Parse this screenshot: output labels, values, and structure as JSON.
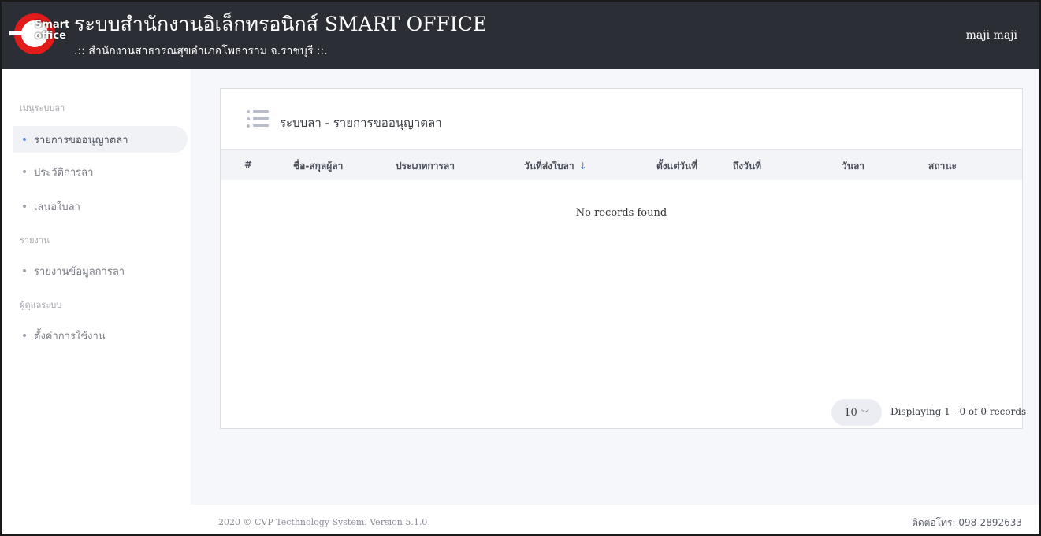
{
  "header": {
    "logo_top": "Smart",
    "logo_bottom": "office",
    "title": "ระบบสำนักงานอิเล็กทรอนิกส์ SMART OFFICE",
    "subtitle": ".:: สำนักงานสาธารณสุขอำเภอโพธาราม จ.ราชบุรี ::.",
    "user": "maji maji"
  },
  "sidebar": {
    "section_menu": "เมนูระบบลา",
    "items": [
      {
        "label": "รายการขออนุญาตลา",
        "active": true
      },
      {
        "label": "ประวัติการลา",
        "active": false
      },
      {
        "label": "เสนอใบลา",
        "active": false
      }
    ],
    "section_report": "รายงาน",
    "report_items": [
      {
        "label": "รายงานข้อมูลการลา"
      }
    ],
    "section_admin": "ผู้ดูแลระบบ",
    "admin_items": [
      {
        "label": "ตั้งค่าการใช้งาน"
      }
    ]
  },
  "main": {
    "card_title": "ระบบลา - รายการขออนุญาตลา",
    "columns": [
      "#",
      "ชื่อ-สกุลผู้ลา",
      "ประเภทการลา",
      "วันที่ส่งใบลา",
      "ตั้งแต่วันที่",
      "ถึงวันที่",
      "วันลา",
      "สถานะ"
    ],
    "sort_indicator": "↓",
    "empty_message": "No records found",
    "page_size": "10",
    "records_text": "Displaying 1 - 0 of 0 records"
  },
  "footer": {
    "copyright": "2020 © CVP Tecthnology System. Version 5.1.0",
    "contact": "ติดต่อโทร: 098-2892633"
  },
  "colors": {
    "header_bg": "#2b2e34",
    "logo_red": "#e21b1b",
    "accent_blue": "#4d7ee6"
  }
}
